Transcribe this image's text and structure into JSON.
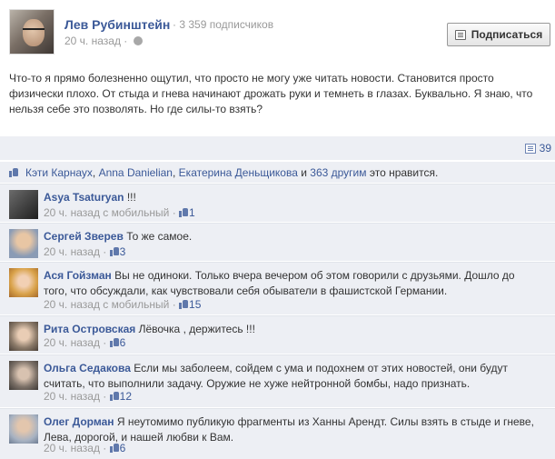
{
  "post": {
    "author": "Лев Рубинштейн",
    "separator": "·",
    "subscribers": "3 359 подписчиков",
    "time": "20 ч. назад",
    "subscribe_label": "Подписаться",
    "text": "Что-то я прямо болезненно ощутил, что просто не могу уже читать новости. Становится просто физически плохо. От стыда и гнева начинают дрожать руки и темнеть в глазах. Буквально. Я знаю, что нельзя себе это позволять. Но где силы-то взять?",
    "shares": "39"
  },
  "likes": {
    "names": [
      "Кэти Карнаух",
      "Anna Danielian",
      "Екатерина Деньщикова"
    ],
    "sep1": ",",
    "sep2": ",",
    "and": "и",
    "others": "363 другим",
    "suffix": "это нравится."
  },
  "meta": {
    "mobile_suffix": "с мобильный",
    "dot": "·"
  },
  "comments": [
    {
      "name": "Asya Tsaturyan",
      "text": "!!!",
      "time": "20 ч. назад",
      "mobile": true,
      "likes": "1"
    },
    {
      "name": "Сергей Зверев",
      "text": "То же самое.",
      "time": "20 ч. назад",
      "mobile": false,
      "likes": "3"
    },
    {
      "name": "Ася Гойзман",
      "text": "Вы не одиноки. Только вчера вечером об этом говорили с друзьями. Дошло до того, что обсуждали, как чувствовали себя обыватели в фашистской Германии.",
      "time": "20 ч. назад",
      "mobile": true,
      "likes": "15"
    },
    {
      "name": "Рита Островская",
      "text": "Лёвочка , держитесь !!!",
      "time": "20 ч. назад",
      "mobile": false,
      "likes": "6"
    },
    {
      "name": "Ольга Седакова",
      "text": "Если мы заболеем, сойдем с ума и подохнем от этих новостей, они будут считать, что выполнили задачу. Оружие не хуже нейтронной бомбы, надо признать.",
      "time": "20 ч. назад",
      "mobile": false,
      "likes": "12"
    },
    {
      "name": "Олег Дорман",
      "text": "Я неутомимо публикую фрагменты из Ханны Арендт. Силы взять в стыде и гневе, Лева, дорогой, и нашей любви к Вам.",
      "time": "20 ч. назад",
      "mobile": false,
      "likes": "6"
    }
  ],
  "colors": {
    "link": "#3b5998",
    "panel": "#edeff4",
    "muted": "#999999"
  }
}
